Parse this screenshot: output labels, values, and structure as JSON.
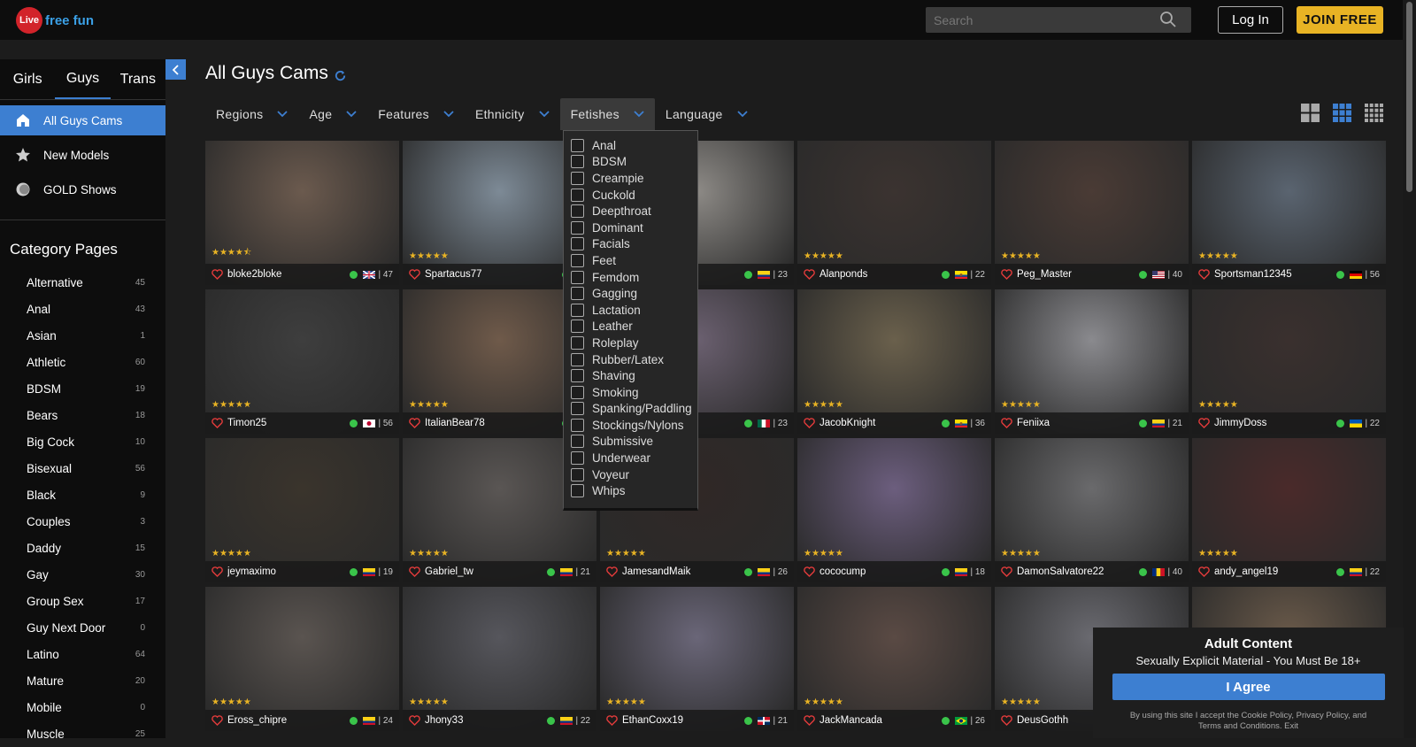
{
  "header": {
    "logo_mark": "Live",
    "logo_text": "free fun",
    "search_placeholder": "Search",
    "login_label": "Log In",
    "join_label": "JOIN FREE"
  },
  "sidebar": {
    "tabs": [
      "Girls",
      "Guys",
      "Trans"
    ],
    "active_tab": "Guys",
    "nav": [
      {
        "label": "All Guys Cams",
        "icon": "home-icon",
        "active": true
      },
      {
        "label": "New Models",
        "icon": "star-icon",
        "active": false
      },
      {
        "label": "GOLD Shows",
        "icon": "coin-icon",
        "active": false
      }
    ],
    "category_title": "Category Pages",
    "categories": [
      {
        "label": "Alternative",
        "count": "45"
      },
      {
        "label": "Anal",
        "count": "43"
      },
      {
        "label": "Asian",
        "count": "1"
      },
      {
        "label": "Athletic",
        "count": "60"
      },
      {
        "label": "BDSM",
        "count": "19"
      },
      {
        "label": "Bears",
        "count": "18"
      },
      {
        "label": "Big Cock",
        "count": "10"
      },
      {
        "label": "Bisexual",
        "count": "56"
      },
      {
        "label": "Black",
        "count": "9"
      },
      {
        "label": "Couples",
        "count": "3"
      },
      {
        "label": "Daddy",
        "count": "15"
      },
      {
        "label": "Gay",
        "count": "30"
      },
      {
        "label": "Group Sex",
        "count": "17"
      },
      {
        "label": "Guy Next Door",
        "count": "0"
      },
      {
        "label": "Latino",
        "count": "64"
      },
      {
        "label": "Mature",
        "count": "20"
      },
      {
        "label": "Mobile",
        "count": "0"
      },
      {
        "label": "Muscle",
        "count": "25"
      }
    ]
  },
  "main": {
    "title": "All Guys Cams",
    "filters": [
      "Regions",
      "Age",
      "Features",
      "Ethnicity",
      "Fetishes",
      "Language"
    ],
    "open_filter": "Fetishes",
    "fetish_options": [
      "Anal",
      "BDSM",
      "Creampie",
      "Cuckold",
      "Deepthroat",
      "Dominant",
      "Facials",
      "Feet",
      "Femdom",
      "Gagging",
      "Lactation",
      "Leather",
      "Roleplay",
      "Rubber/Latex",
      "Shaving",
      "Smoking",
      "Spanking/Paddling",
      "Stockings/Nylons",
      "Submissive",
      "Underwear",
      "Voyeur",
      "Whips"
    ],
    "stars": "★★★★★",
    "cards": [
      {
        "name": "bloke2bloke",
        "age": "47",
        "flag": "uk",
        "stars": "★★★★⯪",
        "color": "#6b5a4e"
      },
      {
        "name": "Spartacus77",
        "age": "",
        "flag": "blue",
        "stars": "★★★★★",
        "color": "#7d8a96"
      },
      {
        "name": "",
        "age": "23",
        "flag": "co",
        "stars": "",
        "color": "#8d8a86"
      },
      {
        "name": "Alanponds",
        "age": "22",
        "flag": "ec",
        "stars": "★★★★★",
        "color": "#3b3330"
      },
      {
        "name": "Peg_Master",
        "age": "40",
        "flag": "us",
        "stars": "★★★★★",
        "color": "#4a3b35"
      },
      {
        "name": "Sportsman12345",
        "age": "56",
        "flag": "de",
        "stars": "★★★★★",
        "color": "#5a6470"
      },
      {
        "name": "Timon25",
        "age": "56",
        "flag": "jp",
        "stars": "★★★★★",
        "color": "#3e3e3e"
      },
      {
        "name": "ItalianBear78",
        "age": "",
        "flag": "it",
        "stars": "★★★★★",
        "color": "#6f5a4a"
      },
      {
        "name": "",
        "age": "23",
        "flag": "mx",
        "stars": "",
        "color": "#6b6070"
      },
      {
        "name": "JacobKnight",
        "age": "36",
        "flag": "ec",
        "stars": "★★★★★",
        "color": "#6a604c"
      },
      {
        "name": "Feniixa",
        "age": "21",
        "flag": "co",
        "stars": "★★★★★",
        "color": "#8a8a8e"
      },
      {
        "name": "JimmyDoss",
        "age": "22",
        "flag": "ua",
        "stars": "★★★★★",
        "color": "#3a302e"
      },
      {
        "name": "jeymaximo",
        "age": "19",
        "flag": "co",
        "stars": "★★★★★",
        "color": "#3a342c"
      },
      {
        "name": "Gabriel_tw",
        "age": "21",
        "flag": "co",
        "stars": "★★★★★",
        "color": "#5a5654"
      },
      {
        "name": "JamesandMaik",
        "age": "26",
        "flag": "co",
        "stars": "★★★★★",
        "color": "#302826"
      },
      {
        "name": "cococump",
        "age": "18",
        "flag": "co",
        "stars": "★★★★★",
        "color": "#6c5e7e"
      },
      {
        "name": "DamonSalvatore22",
        "age": "40",
        "flag": "ro",
        "stars": "★★★★★",
        "color": "#6a6a6c"
      },
      {
        "name": "andy_angel19",
        "age": "22",
        "flag": "co",
        "stars": "★★★★★",
        "color": "#4a2a2a"
      },
      {
        "name": "Eross_chipre",
        "age": "24",
        "flag": "co",
        "stars": "★★★★★",
        "color": "#5a5450"
      },
      {
        "name": "Jhony33",
        "age": "22",
        "flag": "co",
        "stars": "★★★★★",
        "color": "#56565c"
      },
      {
        "name": "EthanCoxx19",
        "age": "21",
        "flag": "do",
        "stars": "★★★★★",
        "color": "#6a6678"
      },
      {
        "name": "JackMancada",
        "age": "26",
        "flag": "br",
        "stars": "★★★★★",
        "color": "#5a4a44"
      },
      {
        "name": "DeusGothh",
        "age": "",
        "flag": "",
        "stars": "★★★★★",
        "color": "#6a6a70"
      },
      {
        "name": "",
        "age": "",
        "flag": "",
        "stars": "",
        "color": "#6a5a4a"
      }
    ]
  },
  "modal": {
    "title": "Adult Content",
    "subtitle": "Sexually Explicit Material - You Must Be 18+",
    "button": "I Agree",
    "fine_print": "By using this site I accept the Cookie Policy, Privacy Policy, and Terms and Conditions. Exit"
  }
}
